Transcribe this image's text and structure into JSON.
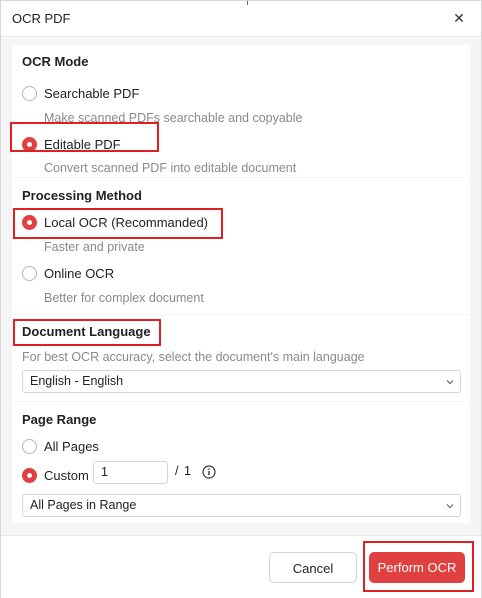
{
  "dialog": {
    "title": "OCR PDF",
    "close_icon": "close-icon"
  },
  "ocr_mode": {
    "title": "OCR Mode",
    "options": [
      {
        "label": "Searchable PDF",
        "desc": "Make scanned PDFs searchable and copyable",
        "checked": false
      },
      {
        "label": "Editable PDF",
        "desc": "Convert scanned PDF into editable document",
        "checked": true
      }
    ]
  },
  "processing": {
    "title": "Processing Method",
    "options": [
      {
        "label": "Local OCR (Recommanded)",
        "desc": "Faster and private",
        "checked": true
      },
      {
        "label": "Online OCR",
        "desc": "Better for complex document",
        "checked": false
      }
    ]
  },
  "language": {
    "title": "Document Language",
    "hint": "For best OCR accuracy, select the document's main language",
    "selected": "English - English"
  },
  "page_range": {
    "title": "Page Range",
    "all_pages_label": "All Pages",
    "custom_label": "Custom",
    "custom_value": "1",
    "slash_total": "/ 1",
    "range_select": "All Pages in Range",
    "all_checked": false,
    "custom_checked": true
  },
  "footer": {
    "cancel_label": "Cancel",
    "perform_label": "Perform OCR"
  },
  "colors": {
    "accent": "#e0403f",
    "highlight": "#e02020"
  }
}
